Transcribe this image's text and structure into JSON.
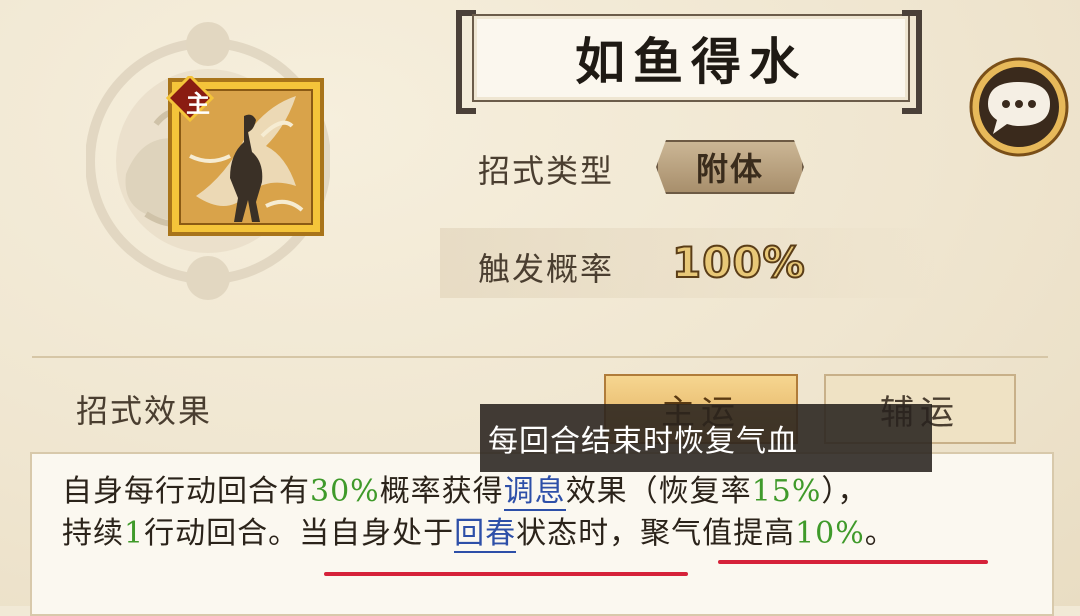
{
  "skill": {
    "name": "如鱼得水",
    "role_badge": "主",
    "type_label": "招式类型",
    "type_value": "附体",
    "rate_label": "触发概率",
    "rate_value": "100%"
  },
  "effects": {
    "section_label": "招式效果",
    "tabs": [
      {
        "label": "主运",
        "active": true
      },
      {
        "label": "辅运",
        "active": false
      }
    ],
    "desc_line1": {
      "p1": "自身每行动回合有",
      "v1": "30%",
      "p2": "概率获得",
      "link1": "调息",
      "p3": "效果（恢复率",
      "v2": "15%",
      "p4": "），"
    },
    "desc_line2": {
      "p1": "持续",
      "v1": "1",
      "p2": "行动回合。当自身处于",
      "link1": "回春",
      "p3": "状态时，聚气值提高",
      "v2": "10%",
      "p4": "。"
    },
    "tooltip": "每回合结束时恢复气血"
  },
  "icons": {
    "chat": "chat-bubble-icon",
    "emblem": "cloud-emblem-icon",
    "skill": "skill-figure-icon"
  },
  "colors": {
    "highlight_green": "#3f9a2a",
    "link_blue": "#2d4fa8",
    "annotation_red": "#d6223a",
    "active_tab": "#e0ac5c"
  }
}
